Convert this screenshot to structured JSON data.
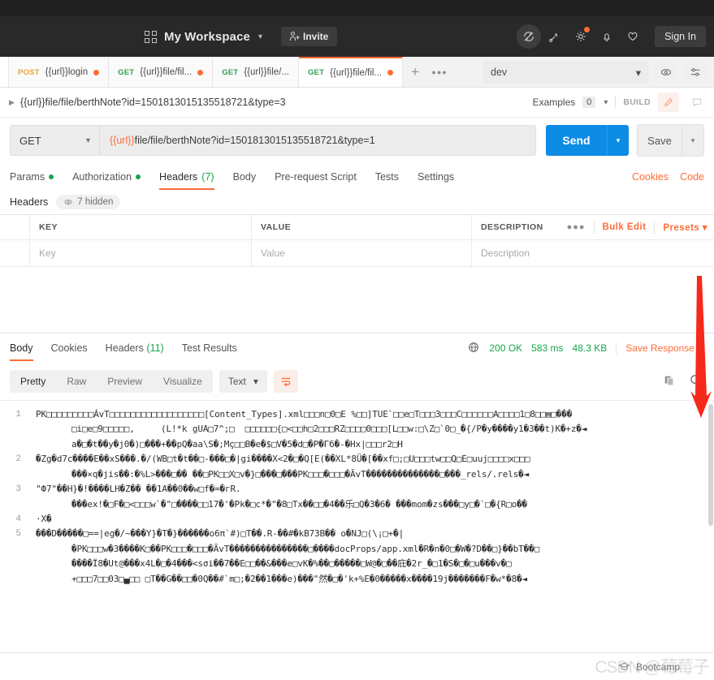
{
  "header": {
    "workspace": "My Workspace",
    "invite_label": "Invite",
    "signin_label": "Sign In",
    "icons": {
      "grid": "grid-icon",
      "sync": "sync-off-icon",
      "broadcast": "satellite-icon",
      "settings": "gear-icon",
      "notifications": "bell-icon",
      "favorites": "heart-icon"
    }
  },
  "tabs": [
    {
      "method": "POST",
      "name": "{{url}}login",
      "unsaved": true,
      "selected": false
    },
    {
      "method": "GET",
      "name": "{{url}}file/fil...",
      "unsaved": true,
      "selected": false
    },
    {
      "method": "GET",
      "name": "{{url}}file/...",
      "unsaved": false,
      "selected": false
    },
    {
      "method": "GET",
      "name": "{{url}}file/fil...",
      "unsaved": true,
      "selected": true
    }
  ],
  "tab_add_label": "+",
  "tab_more_label": "●●●",
  "environment": {
    "selected": "dev",
    "eye_icon": "eye-icon",
    "settings_icon": "sliders-icon"
  },
  "request_description": {
    "title": "{{url}}file/file/berthNote?id=1501813015135518721&type=3",
    "examples_label": "Examples",
    "examples_count": "0",
    "build_label": "BUILD",
    "edit_icon": "pencil-icon",
    "comment_icon": "comment-icon"
  },
  "request": {
    "method": "GET",
    "url_var": "{{url}}",
    "url_rest": "file/file/berthNote?id=1501813015135518721&type=1",
    "send_label": "Send",
    "save_label": "Save"
  },
  "request_tabs": [
    {
      "label": "Params",
      "dot": true,
      "count": "",
      "active": false
    },
    {
      "label": "Authorization",
      "dot": true,
      "count": "",
      "active": false
    },
    {
      "label": "Headers",
      "dot": false,
      "count": "(7)",
      "active": true
    },
    {
      "label": "Body",
      "dot": false,
      "count": "",
      "active": false
    },
    {
      "label": "Pre-request Script",
      "dot": false,
      "count": "",
      "active": false
    },
    {
      "label": "Tests",
      "dot": false,
      "count": "",
      "active": false
    },
    {
      "label": "Settings",
      "dot": false,
      "count": "",
      "active": false
    }
  ],
  "request_tabs_right": [
    {
      "label": "Cookies"
    },
    {
      "label": "Code"
    }
  ],
  "headers_section": {
    "label": "Headers",
    "hidden_label": "7 hidden",
    "columns": [
      "KEY",
      "VALUE",
      "DESCRIPTION"
    ],
    "placeholder_row": [
      "Key",
      "Value",
      "Description"
    ],
    "bulk_edit_label": "Bulk Edit",
    "presets_label": "Presets",
    "more_label": "●●●"
  },
  "response_tabs": [
    {
      "label": "Body",
      "count": "",
      "active": true
    },
    {
      "label": "Cookies",
      "count": "",
      "active": false
    },
    {
      "label": "Headers",
      "count": "(11)",
      "active": false
    },
    {
      "label": "Test Results",
      "count": "",
      "active": false
    }
  ],
  "response_meta": {
    "globe_icon": "globe-icon",
    "status": "200 OK",
    "time": "583 ms",
    "size": "48.3 KB",
    "save_response_label": "Save Response"
  },
  "format_bar": {
    "modes": [
      "Pretty",
      "Raw",
      "Preview",
      "Visualize"
    ],
    "active_mode": "Pretty",
    "type": "Text",
    "wrap_icon": "word-wrap-icon",
    "copy_icon": "copy-icon",
    "search_icon": "search-icon"
  },
  "response_body": {
    "lines": [
      {
        "number": "1",
        "rows": [
          "PK□□□□□□□□□ÁvT□□□□□□□□□□□□□□□□□□[Content_Types].xml□□□n□0□E %□□]TUE`□□e□T□□□3□□□C□□□□□□A□□□□1□8□□▤□���",
          "□i□e□9□□□□□,     (L!*k gUA□7^;□  □□□□□□{□<□□h□2□□□RZ□□□□0□□□[L□□w:□\\Z□`0□_�{/P�y����y1�3��t)K�+z�◄",
          "a�□�t��y�j0�)□���+��pQ�aa\\S�;Mç□□B�e�$□V�5�d□�P�Гб�-�Hx|□□□r2□H"
        ]
      },
      {
        "number": "2",
        "rows": [
          "�Zg�d7c����E��xS���.�/(WB□t�t��□-���□�|gi����X<2�□�Q[E(��XL*8Ü�[��xf□;□U□□□tw□□Q□E□uuj□□□□x□□□",
          "���×q�jis��:�%L>���□�� ��□PK□□X□v�}□���□���PK□□□�□□□�ÃvT��������������□���_rels/.rels�◄"
        ]
      },
      {
        "number": "3",
        "rows": [
          "\"Ф7\"��H}�!����LH�Z�� ��1A��0��w□f�=�гR.",
          "���eх!�□F�□<□□□w`�\"□����□□17�'�Pk�□c*�\"�8□Tx��□□�4��乐□Q�3�6� ���mom�zs���□y□�`□�{R□o��"
        ]
      },
      {
        "number": "4",
        "rows": [
          "·X�"
        ]
      },
      {
        "number": "5",
        "rows": [
          "���D�����□==|eg�/~���Y}�T�}������o6π`#)□T��.R-��#�kB73B�� o�NJ□(\\¡□+�|",
          "�PK□□□w�3����K□��PK□□□�□□□�ÃvT���������������□����docProps/app.xml�R�n�0□�W�?D��□}��bT��□",
          "����Ï8�Ut@���x4L�□�4���<ѕσi��7��E□□��&���e□vK�%��□�����□W@�□��庇�2r_�□1�S�□�□u���v�□",
          "+□□□7□□03□▄□□ □T��G��□□�0Q��#`m□;�2��1���e)���\"然�□�'k+%E�0�����x����19j�������F�w*�8�◄"
        ]
      }
    ]
  },
  "statusbar": {
    "bootcamp_label": "Bootcamp",
    "bootcamp_icon": "graduation-cap-icon"
  },
  "annotation": {
    "arrow_color": "#f52a1c"
  },
  "watermark": {
    "text": "CSDN @莓莓子"
  },
  "colors": {
    "accent": "#ff6c37",
    "send_blue": "#0d8ce6",
    "ok_green": "#19a54b",
    "dark_header": "#292929"
  }
}
